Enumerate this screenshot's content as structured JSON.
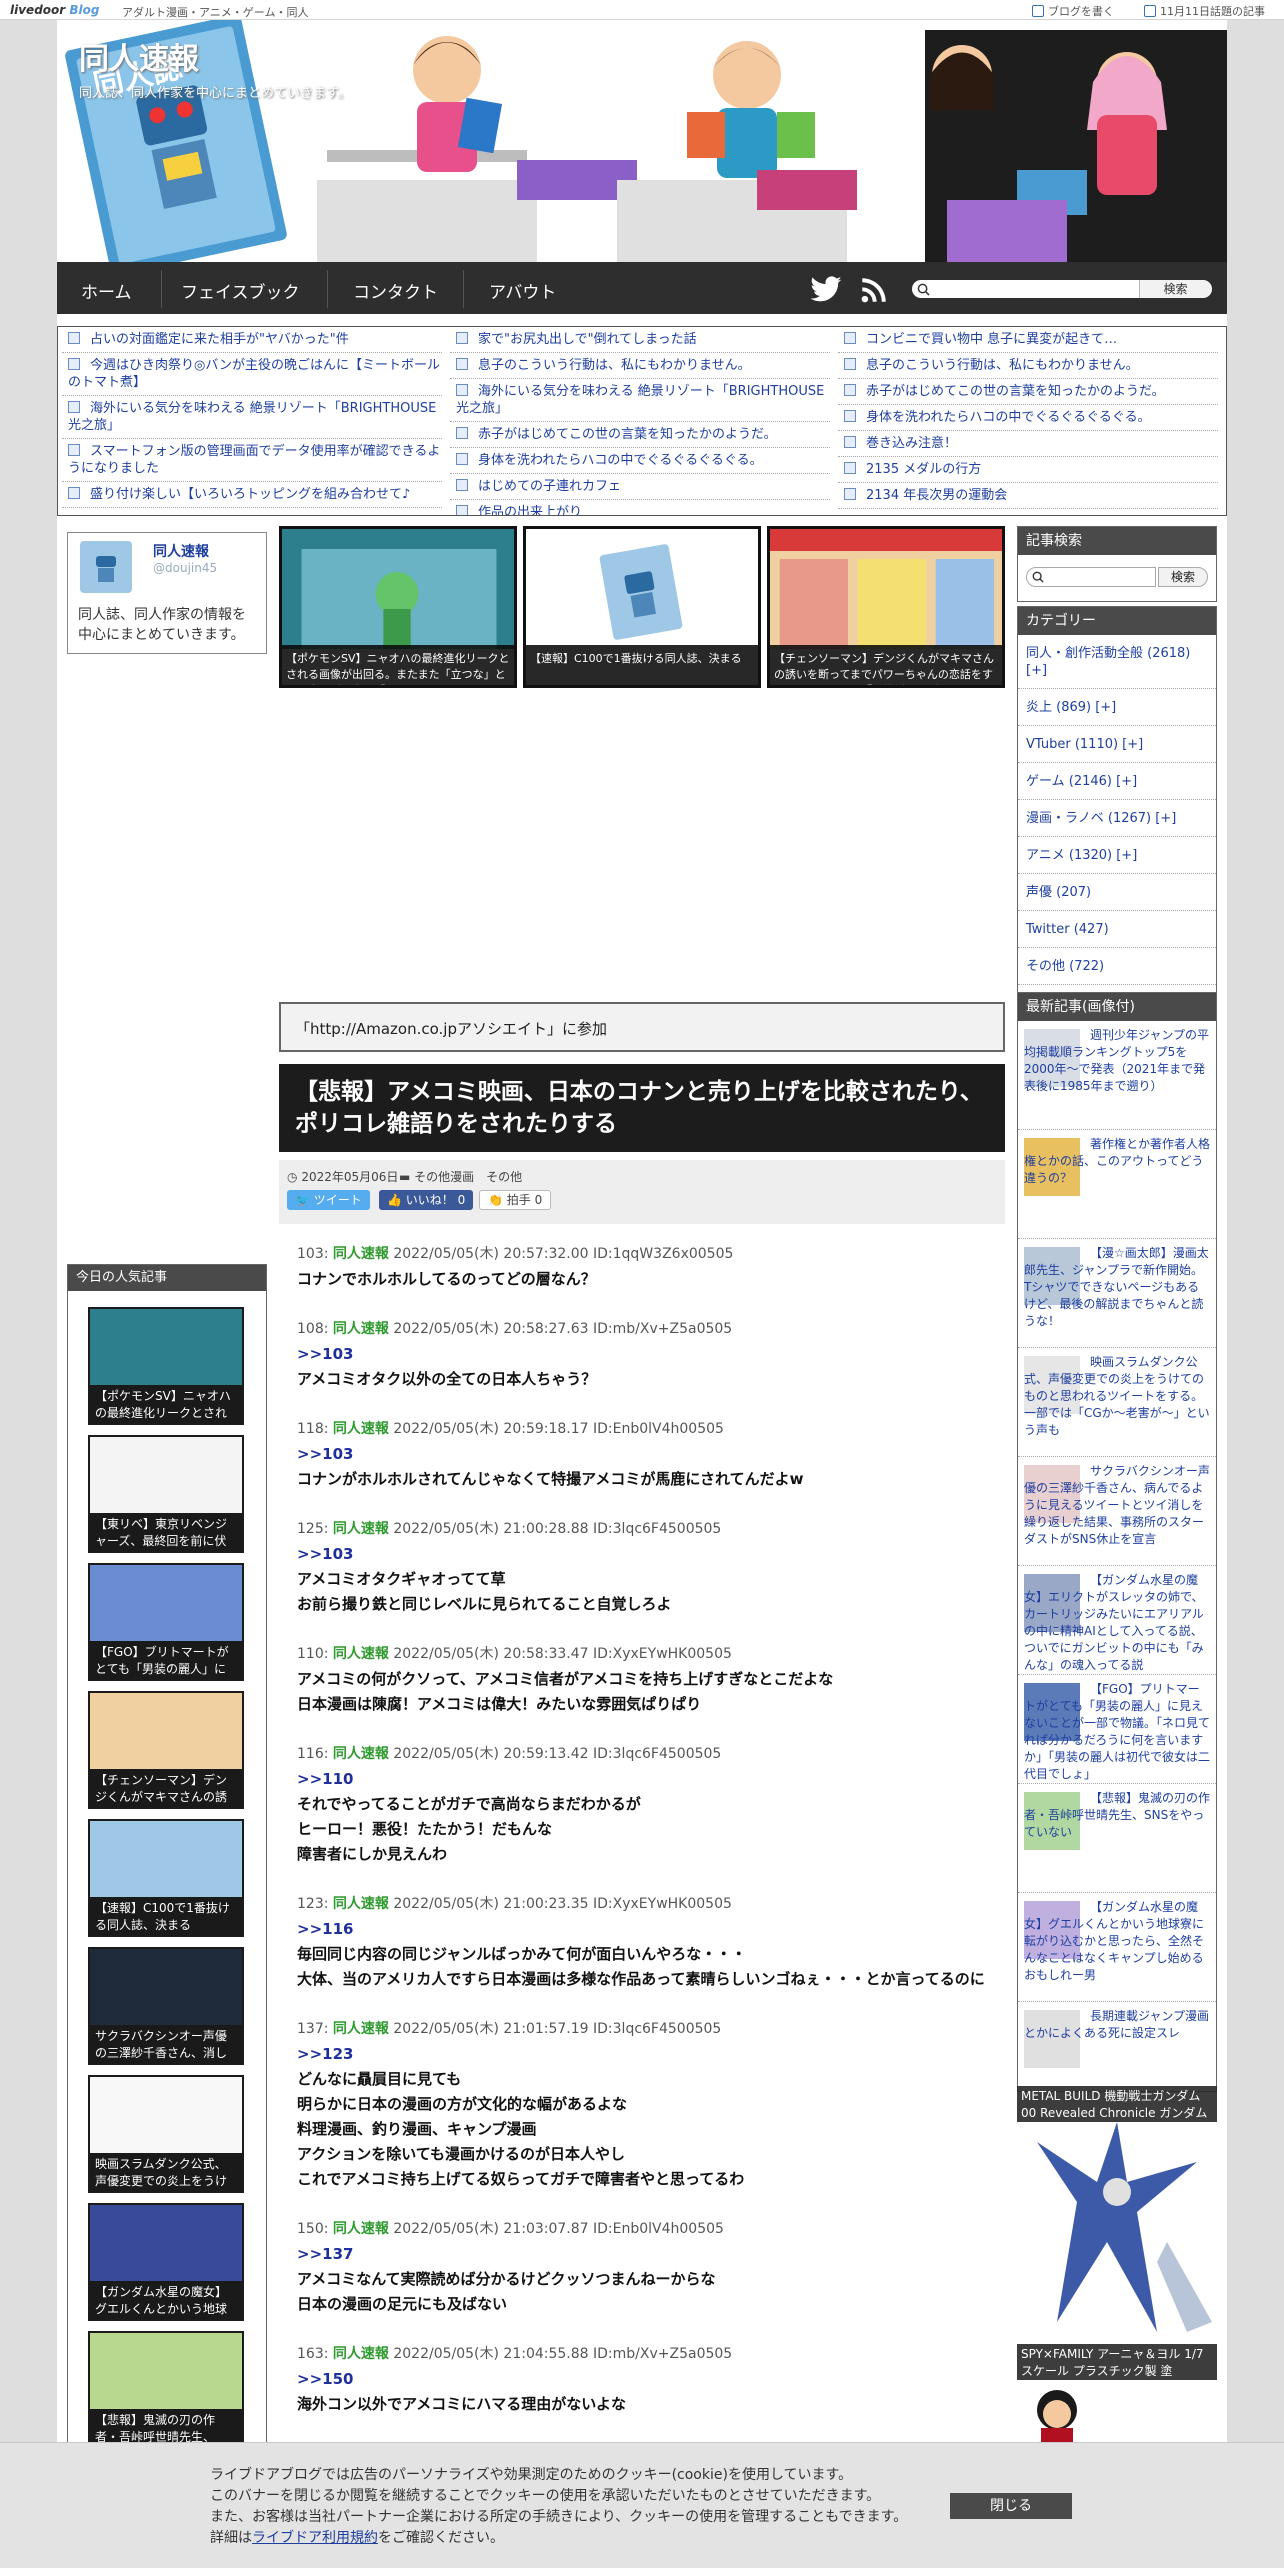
{
  "topbar": {
    "logo": "livedoor",
    "logo2": "Blog",
    "categories": "アダルト漫画・アニメ・ゲーム・同人",
    "write_blog": "ブログを書く",
    "today_topic": "11月11日話題の記事"
  },
  "header": {
    "title": "同人速報",
    "description": "同人誌、同人作家を中心にまとめていきます。"
  },
  "nav": {
    "items": [
      "ホーム",
      "フェイスブック",
      "コンタクト",
      "アバウト"
    ],
    "search_button": "検索"
  },
  "feed": {
    "col1": [
      "占いの対面鑑定に来た相手が\"ヤバかった\"件",
      "今週はひき肉祭り◎バンが主役の晩ごはんに【ミートボールのトマト煮】",
      "海外にいる気分を味わえる 絶景リゾート「BRIGHTHOUSE 光之旅」",
      "スマートフォン版の管理画面でデータ使用率が確認できるようになりました",
      "盛り付け楽しい【いろいろトッピングを組み合わせて♪"
    ],
    "col2": [
      "家で\"お尻丸出しで\"倒れてしまった話",
      "息子のこういう行動は、私にもわかりません。",
      "海外にいる気分を味わえる 絶景リゾート「BRIGHTHOUSE 光之旅」",
      "赤子がはじめてこの世の言葉を知ったかのようだ。",
      "身体を洗われたらハコの中でぐるぐるぐるぐる。",
      "はじめての子連れカフェ",
      "作品の出来上がり"
    ],
    "col3": [
      "コンビニで買い物中 息子に異変が起きて…",
      "息子のこういう行動は、私にもわかりません。",
      "赤子がはじめてこの世の言葉を知ったかのようだ。",
      "身体を洗われたらハコの中でぐるぐるぐるぐる。",
      "巻き込み注意！",
      "2135 メダルの行方",
      "2134 年長次男の運動会"
    ]
  },
  "profile": {
    "name": "同人速報",
    "id": "@doujin45",
    "description": "同人誌、同人作家の情報を中心にまとめていきます。"
  },
  "thumbs": [
    {
      "caption": "【ポケモンSV】ニャオハの最終進化リークとされる画像が出回る。またまた「立つな」という意見が国立へ「ネタバレ」"
    },
    {
      "caption": "【速報】C100で1番抜ける同人誌、決まる"
    },
    {
      "caption": "【チェンソーマン】デンジくんがマキマさんの誘いを断ってまでパワーちゃんの恋話をするなんて…そして『最終話にこぎ』"
    }
  ],
  "amazon": "「http://Amazon.co.jpアソシエイト」に参加",
  "article": {
    "title": "【悲報】アメコミ映画、日本のコナンと売り上げを比較されたり、ポリコレ雑語りをされたりする",
    "date": "2022年05月06日",
    "tags": "その他漫画　その他",
    "tweet": "ツイート",
    "like": "いいね！ 0",
    "clap": "拍手 0"
  },
  "comments": [
    {
      "num": "103:",
      "name": "同人速報",
      "meta": "2022/05/05(木) 20:57:32.00 ID:1qqW3Z6x00505",
      "reply": "",
      "lines": [
        "コナンでホルホルしてるのってどの層なん？"
      ]
    },
    {
      "num": "108:",
      "name": "同人速報",
      "meta": "2022/05/05(木) 20:58:27.63 ID:mb/Xv+Z5a0505",
      "reply": ">>103",
      "lines": [
        "アメコミオタク以外の全ての日本人ちゃう？"
      ]
    },
    {
      "num": "118:",
      "name": "同人速報",
      "meta": "2022/05/05(木) 20:59:18.17 ID:Enb0lV4h00505",
      "reply": ">>103",
      "lines": [
        "コナンがホルホルされてんじゃなくて特撮アメコミが馬鹿にされてんだよw"
      ]
    },
    {
      "num": "125:",
      "name": "同人速報",
      "meta": "2022/05/05(木) 21:00:28.88 ID:3lqc6F4500505",
      "reply": ">>103",
      "lines": [
        "アメコミオタクギャオってて草",
        "お前ら撮り鉄と同じレベルに見られてること自覚しろよ"
      ]
    },
    {
      "num": "110:",
      "name": "同人速報",
      "meta": "2022/05/05(木) 20:58:33.47 ID:XyxEYwHK00505",
      "reply": "",
      "lines": [
        "アメコミの何がクソって、アメコミ信者がアメコミを持ち上げすぎなとこだよな",
        "日本漫画は陳腐！アメコミは偉大！みたいな雰囲気ぱりぱり"
      ]
    },
    {
      "num": "116:",
      "name": "同人速報",
      "meta": "2022/05/05(木) 20:59:13.42 ID:3lqc6F4500505",
      "reply": ">>110",
      "lines": [
        "それでやってることがガチで高尚ならまだわかるが",
        "ヒーロー！悪役！たたかう！だもんな",
        "障害者にしか見えんわ"
      ]
    },
    {
      "num": "123:",
      "name": "同人速報",
      "meta": "2022/05/05(木) 21:00:23.35 ID:XyxEYwHK00505",
      "reply": ">>116",
      "lines": [
        "毎回同じ内容の同じジャンルばっかみて何が面白いんやろな・・・",
        "大体、当のアメリカ人ですら日本漫画は多様な作品あって素晴らしいンゴねぇ・・・とか言ってるのに"
      ]
    },
    {
      "num": "137:",
      "name": "同人速報",
      "meta": "2022/05/05(木) 21:01:57.19 ID:3lqc6F4500505",
      "reply": ">>123",
      "lines": [
        "どんなに贔屓目に見ても",
        "明らかに日本の漫画の方が文化的な幅があるよな",
        "料理漫画、釣り漫画、キャンプ漫画",
        "アクションを除いても漫画かけるのが日本人やし",
        "これでアメコミ持ち上げてる奴らってガチで障害者やと思ってるわ"
      ]
    },
    {
      "num": "150:",
      "name": "同人速報",
      "meta": "2022/05/05(木) 21:03:07.87 ID:Enb0lV4h00505",
      "reply": ">>137",
      "lines": [
        "アメコミなんて実際読めば分かるけどクッソつまんねーからな",
        "日本の漫画の足元にも及ばない"
      ]
    },
    {
      "num": "163:",
      "name": "同人速報",
      "meta": "2022/05/05(木) 21:04:55.88 ID:mb/Xv+Z5a0505",
      "reply": ">>150",
      "lines": [
        "海外コン以外でアメコミにハマる理由がないよな"
      ]
    }
  ],
  "sidebar": {
    "search_title": "記事検索",
    "search_button": "検索",
    "category_title": "カテゴリー",
    "categories": [
      "同人・創作活動全般 (2618) [+]",
      "炎上 (869) [+]",
      "VTuber (1110) [+]",
      "ゲーム (2146) [+]",
      "漫画・ラノベ (1267) [+]",
      "アニメ (1320) [+]",
      "声優 (207)",
      "Twitter (427)",
      "その他 (722)"
    ],
    "latest_title": "最新記事(画像付)",
    "latest": [
      "週刊少年ジャンプの平均掲載順ランキングトップ5を2000年〜で発表（2021年まで発表後に1985年まで遡り）",
      "著作権とか著作者人格権とかの話、このアウトってどう違うの？",
      "【漫☆画太郎】漫画太郎先生、ジャンプラで新作開始。Tシャツでできないページもあるけど、最後の解説までちゃんと読うな！",
      "映画スラムダンク公式、声優変更での炎上をうけてのものと思われるツイートをする。一部では「CGか〜老害が〜」という声も",
      "サクラバクシンオー声優の三澤紗千香さん、病んでるように見えるツイートとツイ消しを繰り返した結果、事務所のスターダストがSNS休止を宣言",
      "【ガンダム水星の魔女】エリクトがスレッタの姉で、カートリッジみたいにエアリアルの中に精神AIとして入ってる説、ついでにガンビットの中にも「みんな」の魂入ってる説",
      "【FGO】プリトマートがとても「男装の麗人」に見えないことが一部で物議。「ネロ見てれば分かるだろうに何を言いますか」「男装の麗人は初代で彼女は二代目でしょ」",
      "【悲報】鬼滅の刃の作者・吾峠呼世晴先生、SNSをやっていない",
      "【ガンダム水星の魔女】グエルくんとかいう地球寮に転がり込むかと思ったら、全然そんなことはなくキャンプし始めるおもしれー男",
      "長期連載ジャンプ漫画とかによくある死に設定スレ"
    ],
    "ad1": "METAL BUILD 機動戦士ガンダム00 Revealed Chronicle ガンダム",
    "ad2": "SPY×FAMILY アーニャ＆ヨル 1/7スケール プラスチック製 塗"
  },
  "ranking": {
    "title": "今日の人気記事",
    "items": [
      "【ポケモンSV】ニャオハの最終進化リークとされる",
      "【東リベ】東京リベンジャーズ、最終回を前に伏線を",
      "【FGO】ブリトマートがとても「男装の麗人」に見え",
      "【チェンソーマン】デンジくんがマキマさんの誘いを",
      "【速報】C100で1番抜ける同人誌、決まる",
      "サクラバクシンオー声優の三澤紗千香さん、消したツ",
      "映画スラムダンク公式、声優変更での炎上をうけての",
      "【ガンダム水星の魔女】グエルくんとかいう地球寮に",
      "【悲報】鬼滅の刃の作者・吾峠呼世晴先生、SNSをや"
    ]
  },
  "cookie": {
    "lines": [
      "ライブドアブログでは広告のパーソナライズや効果測定のためのクッキー(cookie)を使用しています。",
      "このバナーを閉じるか閲覧を継続することでクッキーの使用を承認いただいたものとさせていただきます。",
      "また、お客様は当社パートナー企業における所定の手続きにより、クッキーの使用を管理することもできます。"
    ],
    "link_prefix": "詳細は",
    "link": "ライブドア利用規約",
    "link_suffix": "をご確認ください。",
    "close": "閉じる"
  }
}
